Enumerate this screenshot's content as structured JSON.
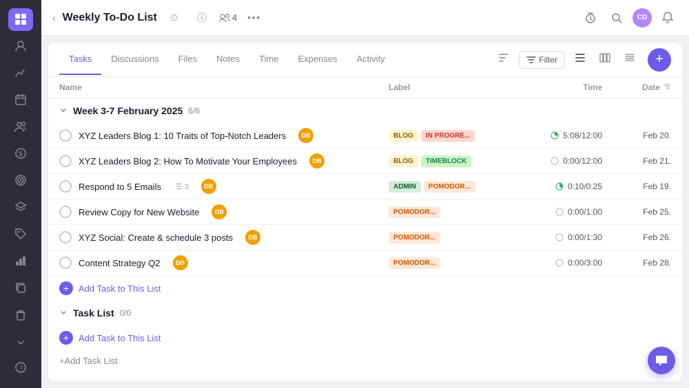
{
  "sidebar": {
    "icons": [
      {
        "name": "grid-icon",
        "symbol": "⊞",
        "active": true
      },
      {
        "name": "user-icon",
        "symbol": "👤",
        "active": false
      },
      {
        "name": "chart-icon",
        "symbol": "📈",
        "active": false
      },
      {
        "name": "calendar-icon",
        "symbol": "📅",
        "active": false
      },
      {
        "name": "people-icon",
        "symbol": "👥",
        "active": false
      },
      {
        "name": "dollar-icon",
        "symbol": "💲",
        "active": false
      },
      {
        "name": "target-icon",
        "symbol": "🎯",
        "active": false
      },
      {
        "name": "layers-icon",
        "symbol": "⬡",
        "active": false
      },
      {
        "name": "clock-tag-icon",
        "symbol": "🏷",
        "active": false
      },
      {
        "name": "bar-chart-icon",
        "symbol": "📊",
        "active": false
      },
      {
        "name": "copy-icon",
        "symbol": "⧉",
        "active": false
      },
      {
        "name": "trash-icon",
        "symbol": "🗑",
        "active": false
      }
    ],
    "bottom_icons": [
      {
        "name": "collapse-icon",
        "symbol": "⌃"
      },
      {
        "name": "help-icon",
        "symbol": "?"
      }
    ]
  },
  "topbar": {
    "back_label": "‹",
    "title": "Weekly To-Do List",
    "status_icon": "⊙",
    "info_icon": "ⓘ",
    "members_count": "4",
    "more_icon": "•••",
    "timer_icon": "⏱",
    "search_icon": "🔍",
    "avatar_initials": "CD",
    "bell_icon": "🔔"
  },
  "tabs": [
    {
      "label": "Tasks",
      "active": true
    },
    {
      "label": "Discussions",
      "active": false
    },
    {
      "label": "Files",
      "active": false
    },
    {
      "label": "Notes",
      "active": false
    },
    {
      "label": "Time",
      "active": false
    },
    {
      "label": "Expenses",
      "active": false
    },
    {
      "label": "Activity",
      "active": false
    }
  ],
  "toolbar": {
    "sort_icon": "≡↕",
    "filter_label": "Filter",
    "filter_icon": "≡",
    "view1_icon": "≡",
    "view2_icon": "⊞",
    "view3_icon": "≡",
    "plus_label": "+"
  },
  "table": {
    "headers": {
      "name": "Name",
      "label": "Label",
      "time": "Time",
      "date": "Date"
    },
    "groups": [
      {
        "title": "Week  3-7 February 2025",
        "count": "6/6",
        "tasks": [
          {
            "name": "XYZ Leaders Blog 1: 10 Traits of Top-Notch Leaders",
            "avatar": "DB",
            "labels": [
              {
                "text": "BLOG",
                "type": "blog"
              },
              {
                "text": "IN PROGRE...",
                "type": "inprog"
              }
            ],
            "time_dot_color": "#27ae60",
            "time_dot_half": true,
            "time": "5:08/12:00",
            "date": "Feb 20."
          },
          {
            "name": "XYZ Leaders Blog 2: How To Motivate Your Employees",
            "avatar": "DB",
            "labels": [
              {
                "text": "BLOG",
                "type": "blog"
              },
              {
                "text": "TIMEBLOCK",
                "type": "timeblock"
              }
            ],
            "time_dot_color": "#ccc",
            "time": "0:00/12:00",
            "date": "Feb 21."
          },
          {
            "name": "Respond to 5 Emails",
            "subtask": "· ☰ 3",
            "avatar": "DB",
            "labels": [
              {
                "text": "ADMIN",
                "type": "admin"
              },
              {
                "text": "POMODOR...",
                "type": "pomodoro"
              }
            ],
            "time_dot_color": "#27ae60",
            "time_dot_half": true,
            "time": "0:10/0:25",
            "date": "Feb 19."
          },
          {
            "name": "Review Copy for New Website",
            "avatar": "DB",
            "labels": [
              {
                "text": "POMODOR...",
                "type": "pomodoro"
              }
            ],
            "time_dot_color": "#ccc",
            "time": "0:00/1:00",
            "date": "Feb 25."
          },
          {
            "name": "XYZ Social: Create & schedule 3 posts",
            "avatar": "DB",
            "labels": [
              {
                "text": "POMODOR...",
                "type": "pomodoro"
              }
            ],
            "time_dot_color": "#ccc",
            "time": "0:00/1:30",
            "date": "Feb 26."
          },
          {
            "name": "Content Strategy Q2",
            "avatar": "DB",
            "labels": [
              {
                "text": "POMODOR...",
                "type": "pomodoro"
              }
            ],
            "time_dot_color": "#ccc",
            "time": "0:00/3:00",
            "date": "Feb 28."
          }
        ],
        "add_task_label": "Add Task to This List"
      },
      {
        "title": "Task List",
        "count": "0/0",
        "tasks": [],
        "add_task_label": "Add Task to This List"
      }
    ],
    "add_list_label": "+Add Task List"
  }
}
